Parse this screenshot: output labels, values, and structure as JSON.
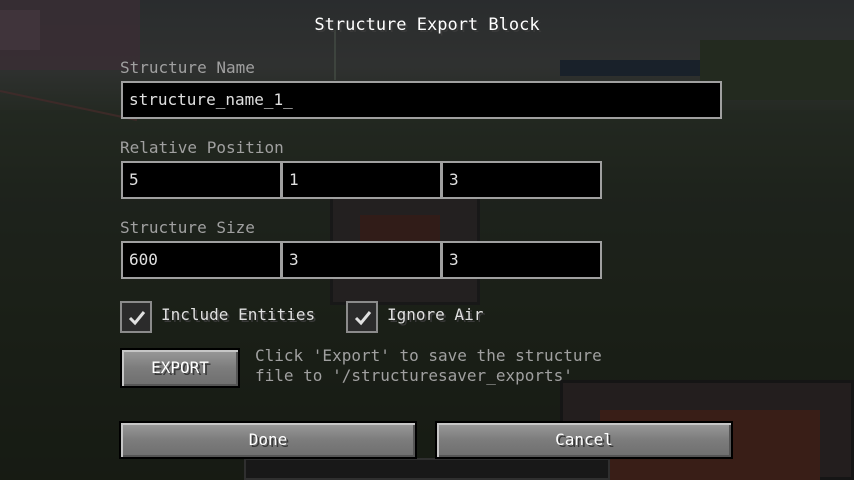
{
  "screen": {
    "title": "Structure Export Block"
  },
  "structure_name": {
    "label": "Structure Name",
    "value": "structure_name_1_"
  },
  "relative_position": {
    "label": "Relative Position",
    "x": "5",
    "y": "1",
    "z": "3"
  },
  "structure_size": {
    "label": "Structure Size",
    "x": "600",
    "y": "3",
    "z": "3"
  },
  "options": {
    "include_entities": {
      "label": "Include Entities",
      "checked": true
    },
    "ignore_air": {
      "label": "Ignore Air",
      "checked": true
    }
  },
  "export": {
    "button_label": "EXPORT",
    "info_line1": "Click 'Export' to save the structure",
    "info_line2": "file to '/structuresaver_exports'"
  },
  "footer": {
    "done_label": "Done",
    "cancel_label": "Cancel"
  }
}
